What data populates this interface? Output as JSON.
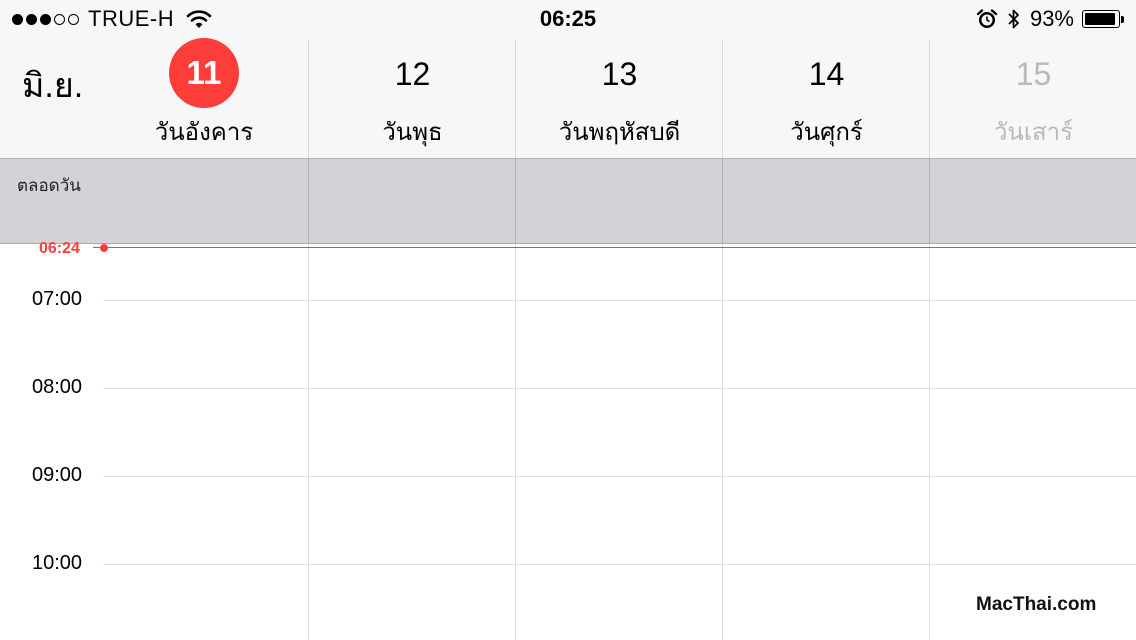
{
  "status_bar": {
    "carrier": "TRUE-H",
    "signal_bars_filled": 3,
    "signal_bars_total": 5,
    "time": "06:25",
    "battery_percent_label": "93%",
    "battery_level": 0.93,
    "icons": [
      "wifi-icon",
      "alarm-icon",
      "bluetooth-icon",
      "battery-icon"
    ]
  },
  "header": {
    "month": "มิ.ย.",
    "days": [
      {
        "number": "11",
        "name": "วันอังคาร",
        "today": true
      },
      {
        "number": "12",
        "name": "วันพุธ"
      },
      {
        "number": "13",
        "name": "วันพฤหัสบดี"
      },
      {
        "number": "14",
        "name": "วันศุกร์"
      },
      {
        "number": "15",
        "name": "วันเสาร์",
        "dimmed": true
      }
    ]
  },
  "all_day": {
    "label": "ตลอดวัน"
  },
  "timeline": {
    "current_time": "06:24",
    "hours": [
      "07:00",
      "08:00",
      "09:00",
      "10:00"
    ]
  },
  "colors": {
    "accent_red": "#fc3d39",
    "header_bg": "#f7f7f7",
    "all_day_bg": "#d2d2d7",
    "dimmed_text": "#b8b8bd"
  },
  "watermark": "MacThai.com"
}
